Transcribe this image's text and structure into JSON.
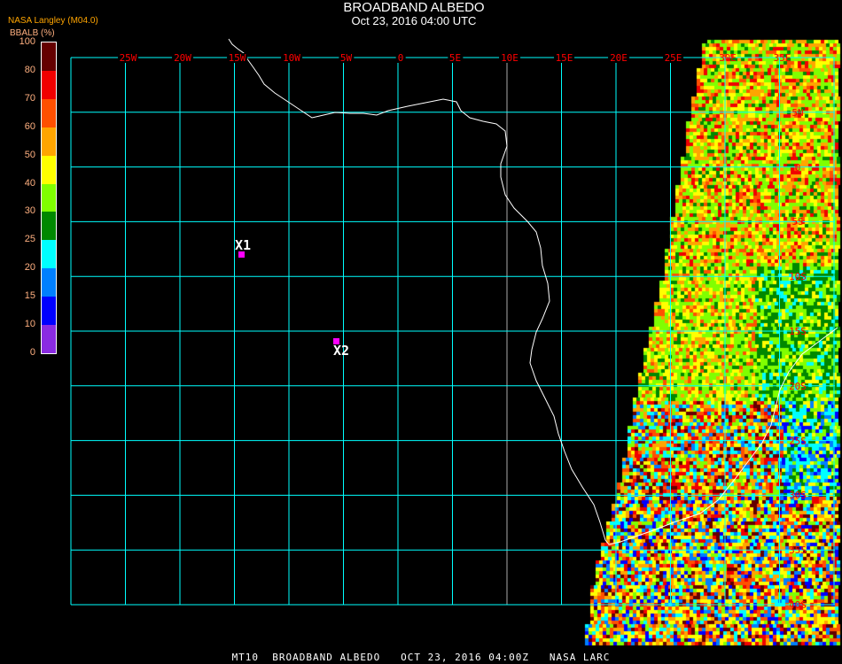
{
  "header": {
    "title": "BROADBAND ALBEDO",
    "subtitle": "Oct 23, 2016 04:00 UTC",
    "producer": "NASA Langley (M04.0)"
  },
  "legend": {
    "units": "BBALB (%)",
    "tick_labels": [
      "0",
      "10",
      "15",
      "20",
      "25",
      "30",
      "40",
      "50",
      "60",
      "70",
      "80",
      "100"
    ],
    "colors": [
      "#8a2be2",
      "#0000ff",
      "#0080ff",
      "#00ffff",
      "#008800",
      "#80ff00",
      "#ffff00",
      "#ffa500",
      "#ff5000",
      "#f00000",
      "#640000"
    ]
  },
  "map": {
    "longitude_labels": [
      "25W",
      "20W",
      "15W",
      "10W",
      "5W",
      "0",
      "5E",
      "10E",
      "15E",
      "20E",
      "25E",
      "30E",
      "35E"
    ],
    "latitude_labels": [
      "5N",
      "0",
      "5S",
      "10S",
      "15S",
      "20S",
      "25S",
      "30S",
      "35S",
      "40S"
    ],
    "grid_color": "#00ffff",
    "label_color": "#ff0000",
    "markers": [
      {
        "label": "X1"
      },
      {
        "label": "X2"
      }
    ]
  },
  "footer": {
    "text": "MT10  BROADBAND ALBEDO   OCT 23, 2016 04:00Z   NASA LARC"
  }
}
